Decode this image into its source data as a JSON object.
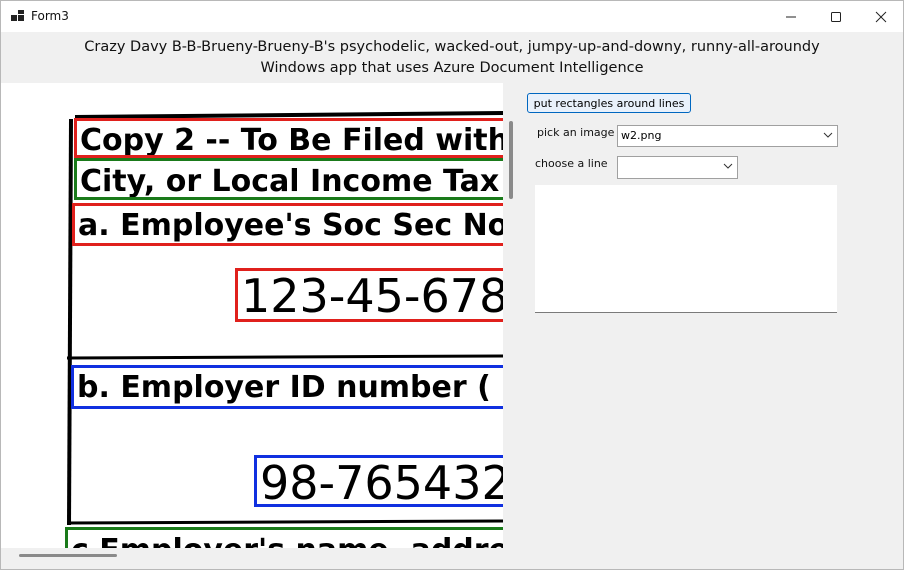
{
  "window": {
    "title": "Form3",
    "header_line1": "Crazy Davy B-B-Brueny-Brueny-B's psychodelic, wacked-out, jumpy-up-and-downy, runny-all-aroundy",
    "header_line2": "Windows app that uses Azure Document Intelligence"
  },
  "document_image": {
    "lines": [
      {
        "text": "Copy 2 -- To Be Filed with",
        "box_color": "#e0201c"
      },
      {
        "text": "City, or Local Income Tax",
        "box_color": "#1a7a1a"
      },
      {
        "text": "a. Employee's Soc Sec No",
        "box_color": "#e0201c"
      },
      {
        "text": "123-45-678",
        "box_color": "#e0201c"
      },
      {
        "text": "b. Employer ID number (",
        "box_color": "#1030e0"
      },
      {
        "text": "98-765432",
        "box_color": "#1030e0"
      },
      {
        "text": "c Employer's name, addre",
        "box_color": "#1a7a1a"
      }
    ]
  },
  "controls": {
    "rect_button_label": "put rectangles around lines",
    "pick_image_label": "pick an image",
    "pick_image_value": "w2.png",
    "choose_line_label": "choose a line",
    "choose_line_value": ""
  },
  "colors": {
    "red": "#e0201c",
    "green": "#1a7a1a",
    "blue": "#1030e0",
    "button_border": "#0067c0"
  }
}
